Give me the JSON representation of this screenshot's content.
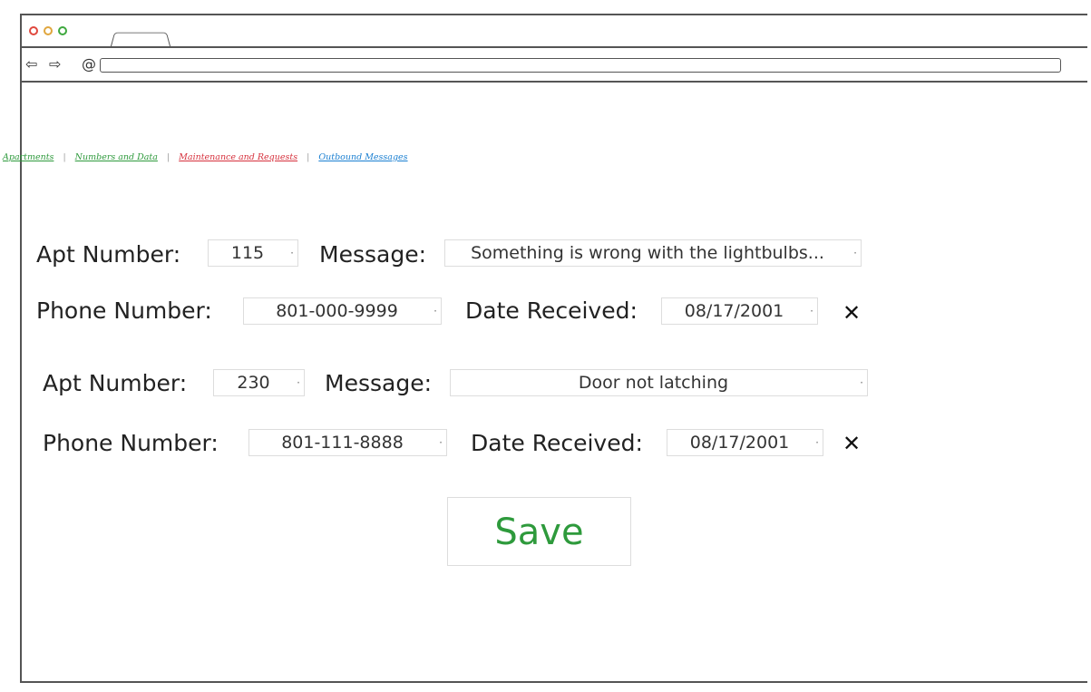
{
  "nav": {
    "links": [
      {
        "label": "Apartments",
        "color": "#2e9a3c"
      },
      {
        "label": "Numbers and Data",
        "color": "#2e9a3c"
      },
      {
        "label": "Maintenance and Requests",
        "color": "#d6303c"
      },
      {
        "label": "Outbound Messages",
        "color": "#1a7fd1"
      }
    ],
    "separator": "|"
  },
  "labels": {
    "apt_number": "Apt Number:",
    "message": "Message:",
    "phone_number": "Phone Number:",
    "date_received": "Date Received:"
  },
  "requests": [
    {
      "apt_number": "115",
      "message": "Something is wrong with the lightbulbs...",
      "phone_number": "801-000-9999",
      "date_received": "08/17/2001"
    },
    {
      "apt_number": "230",
      "message": "Door not latching",
      "phone_number": "801-111-8888",
      "date_received": "08/17/2001"
    }
  ],
  "delete_glyph": "✕",
  "save_label": "Save",
  "icons": {
    "back": "back-arrow-icon",
    "forward": "forward-arrow-icon",
    "reload": "reload-icon",
    "delete": "close-icon"
  }
}
